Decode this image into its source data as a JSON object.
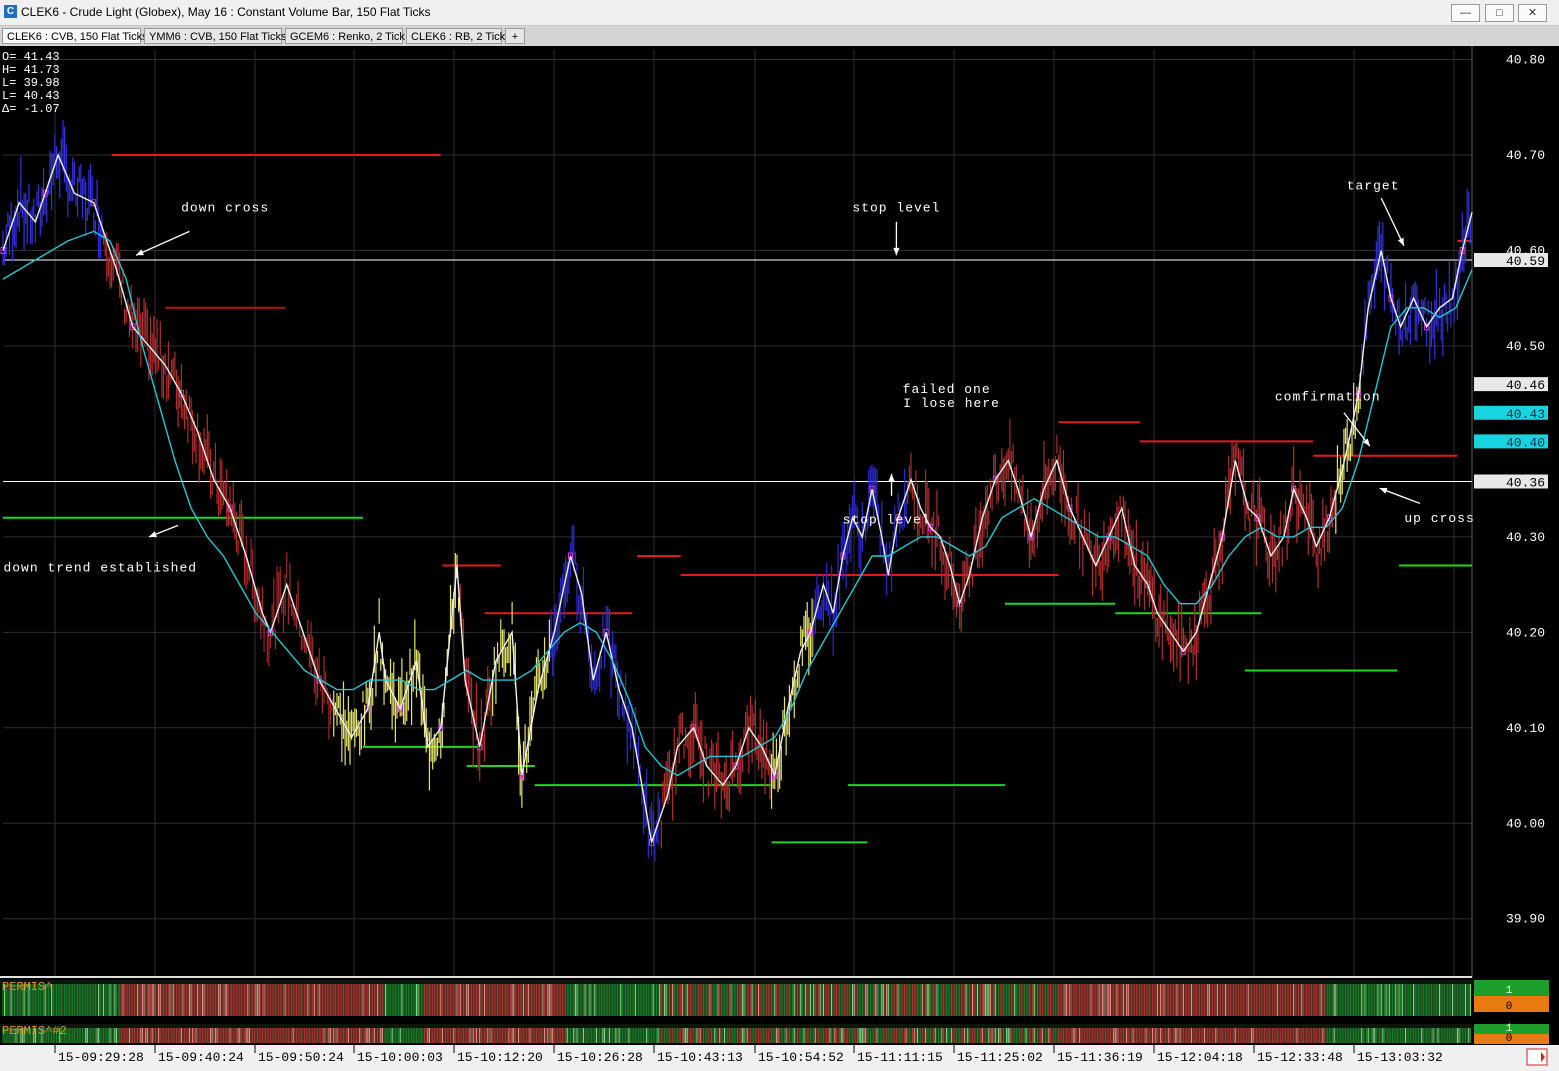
{
  "window": {
    "title": "CLEK6 - Crude Light (Globex), May 16 : Constant Volume Bar, 150 Flat Ticks",
    "minimize_label": "—",
    "maximize_label": "□",
    "close_label": "✕"
  },
  "tabs": [
    {
      "label": "CLEK6 : CVB, 150 Flat Ticks",
      "active": true
    },
    {
      "label": "YMM6 : CVB, 150 Flat Ticks",
      "active": false
    },
    {
      "label": "GCEM6 : Renko, 2 Tick",
      "active": false
    },
    {
      "label": "CLEK6 : RB, 2 Tick",
      "active": false
    }
  ],
  "add_tab_label": "+",
  "ohlc_readout": [
    "O=  41.43",
    "H=  41.73",
    "L=  39.98",
    "L=  40.43",
    "Δ=  -1.07"
  ],
  "chart_data": {
    "type": "line",
    "y_range": [
      39.84,
      40.81
    ],
    "y_ticks": [
      "40.80",
      "40.70",
      "40.60",
      "40.50",
      "40.30",
      "40.20",
      "40.10",
      "40.00",
      "39.90"
    ],
    "x_tick_labels": [
      "15-09:29:28",
      "15-09:40:24",
      "15-09:50:24",
      "15-10:00:03",
      "15-10:12:20",
      "15-10:26:28",
      "15-10:43:13",
      "15-10:54:52",
      "15-11:11:15",
      "15-11:25:02",
      "15-11:36:19",
      "15-12:04:18",
      "15-12:33:48",
      "15-13:03:32"
    ],
    "price_path": [
      [
        0,
        40.6
      ],
      [
        10,
        40.65
      ],
      [
        20,
        40.63
      ],
      [
        26,
        40.66
      ],
      [
        34,
        40.7
      ],
      [
        44,
        40.66
      ],
      [
        56,
        40.65
      ],
      [
        62,
        40.62
      ],
      [
        70,
        40.58
      ],
      [
        80,
        40.52
      ],
      [
        90,
        40.5
      ],
      [
        100,
        40.48
      ],
      [
        110,
        40.45
      ],
      [
        120,
        40.41
      ],
      [
        130,
        40.36
      ],
      [
        140,
        40.33
      ],
      [
        150,
        40.28
      ],
      [
        160,
        40.22
      ],
      [
        165,
        40.2
      ],
      [
        175,
        40.25
      ],
      [
        185,
        40.2
      ],
      [
        195,
        40.15
      ],
      [
        205,
        40.12
      ],
      [
        215,
        40.09
      ],
      [
        225,
        40.12
      ],
      [
        232,
        40.2
      ],
      [
        236,
        40.15
      ],
      [
        245,
        40.12
      ],
      [
        255,
        40.17
      ],
      [
        262,
        40.08
      ],
      [
        270,
        40.1
      ],
      [
        280,
        40.27
      ],
      [
        285,
        40.15
      ],
      [
        294,
        40.08
      ],
      [
        304,
        40.17
      ],
      [
        314,
        40.2
      ],
      [
        320,
        40.05
      ],
      [
        330,
        40.14
      ],
      [
        340,
        40.2
      ],
      [
        350,
        40.28
      ],
      [
        357,
        40.24
      ],
      [
        364,
        40.15
      ],
      [
        372,
        40.2
      ],
      [
        380,
        40.14
      ],
      [
        388,
        40.1
      ],
      [
        400,
        39.98
      ],
      [
        410,
        40.03
      ],
      [
        416,
        40.08
      ],
      [
        426,
        40.1
      ],
      [
        434,
        40.06
      ],
      [
        444,
        40.04
      ],
      [
        452,
        40.06
      ],
      [
        460,
        40.1
      ],
      [
        468,
        40.08
      ],
      [
        476,
        40.05
      ],
      [
        484,
        40.12
      ],
      [
        492,
        40.18
      ],
      [
        498,
        40.2
      ],
      [
        506,
        40.25
      ],
      [
        512,
        40.22
      ],
      [
        518,
        40.28
      ],
      [
        524,
        40.32
      ],
      [
        530,
        40.3
      ],
      [
        536,
        40.35
      ],
      [
        542,
        40.3
      ],
      [
        546,
        40.26
      ],
      [
        552,
        40.32
      ],
      [
        560,
        40.36
      ],
      [
        566,
        40.33
      ],
      [
        572,
        40.31
      ],
      [
        578,
        40.3
      ],
      [
        584,
        40.27
      ],
      [
        590,
        40.23
      ],
      [
        596,
        40.26
      ],
      [
        604,
        40.32
      ],
      [
        612,
        40.36
      ],
      [
        620,
        40.38
      ],
      [
        626,
        40.35
      ],
      [
        634,
        40.3
      ],
      [
        642,
        40.35
      ],
      [
        650,
        40.38
      ],
      [
        658,
        40.33
      ],
      [
        666,
        40.3
      ],
      [
        674,
        40.27
      ],
      [
        682,
        40.3
      ],
      [
        690,
        40.33
      ],
      [
        698,
        40.27
      ],
      [
        706,
        40.25
      ],
      [
        712,
        40.22
      ],
      [
        720,
        40.2
      ],
      [
        728,
        40.18
      ],
      [
        736,
        40.2
      ],
      [
        744,
        40.25
      ],
      [
        752,
        40.3
      ],
      [
        760,
        40.38
      ],
      [
        768,
        40.33
      ],
      [
        774,
        40.32
      ],
      [
        782,
        40.28
      ],
      [
        790,
        40.3
      ],
      [
        796,
        40.35
      ],
      [
        804,
        40.32
      ],
      [
        810,
        40.29
      ],
      [
        818,
        40.32
      ],
      [
        826,
        40.37
      ],
      [
        830,
        40.4
      ],
      [
        836,
        40.45
      ],
      [
        842,
        40.54
      ],
      [
        850,
        40.6
      ],
      [
        856,
        40.55
      ],
      [
        862,
        40.52
      ],
      [
        870,
        40.55
      ],
      [
        878,
        40.52
      ],
      [
        886,
        40.54
      ],
      [
        894,
        40.55
      ],
      [
        900,
        40.6
      ],
      [
        906,
        40.64
      ]
    ],
    "moving_average": [
      [
        0,
        40.57
      ],
      [
        20,
        40.59
      ],
      [
        40,
        40.61
      ],
      [
        56,
        40.62
      ],
      [
        66,
        40.61
      ],
      [
        76,
        40.57
      ],
      [
        86,
        40.5
      ],
      [
        96,
        40.44
      ],
      [
        106,
        40.38
      ],
      [
        116,
        40.33
      ],
      [
        126,
        40.3
      ],
      [
        136,
        40.28
      ],
      [
        146,
        40.25
      ],
      [
        156,
        40.22
      ],
      [
        166,
        40.2
      ],
      [
        176,
        40.18
      ],
      [
        186,
        40.16
      ],
      [
        196,
        40.15
      ],
      [
        206,
        40.14
      ],
      [
        216,
        40.14
      ],
      [
        226,
        40.15
      ],
      [
        236,
        40.15
      ],
      [
        246,
        40.15
      ],
      [
        256,
        40.14
      ],
      [
        266,
        40.14
      ],
      [
        276,
        40.15
      ],
      [
        286,
        40.16
      ],
      [
        296,
        40.15
      ],
      [
        306,
        40.15
      ],
      [
        316,
        40.15
      ],
      [
        326,
        40.16
      ],
      [
        336,
        40.18
      ],
      [
        346,
        40.2
      ],
      [
        356,
        40.21
      ],
      [
        366,
        40.2
      ],
      [
        376,
        40.17
      ],
      [
        386,
        40.13
      ],
      [
        396,
        40.08
      ],
      [
        406,
        40.06
      ],
      [
        416,
        40.05
      ],
      [
        426,
        40.06
      ],
      [
        436,
        40.07
      ],
      [
        446,
        40.07
      ],
      [
        456,
        40.07
      ],
      [
        466,
        40.08
      ],
      [
        476,
        40.09
      ],
      [
        486,
        40.12
      ],
      [
        496,
        40.16
      ],
      [
        506,
        40.19
      ],
      [
        516,
        40.22
      ],
      [
        526,
        40.25
      ],
      [
        536,
        40.28
      ],
      [
        546,
        40.28
      ],
      [
        556,
        40.29
      ],
      [
        566,
        40.3
      ],
      [
        576,
        40.3
      ],
      [
        586,
        40.29
      ],
      [
        596,
        40.28
      ],
      [
        606,
        40.29
      ],
      [
        616,
        40.32
      ],
      [
        626,
        40.33
      ],
      [
        636,
        40.34
      ],
      [
        646,
        40.33
      ],
      [
        656,
        40.32
      ],
      [
        666,
        40.31
      ],
      [
        676,
        40.3
      ],
      [
        686,
        40.3
      ],
      [
        696,
        40.29
      ],
      [
        706,
        40.28
      ],
      [
        716,
        40.25
      ],
      [
        726,
        40.23
      ],
      [
        736,
        40.23
      ],
      [
        746,
        40.25
      ],
      [
        756,
        40.28
      ],
      [
        766,
        40.3
      ],
      [
        776,
        40.31
      ],
      [
        786,
        40.3
      ],
      [
        796,
        40.3
      ],
      [
        806,
        40.31
      ],
      [
        816,
        40.31
      ],
      [
        826,
        40.33
      ],
      [
        836,
        40.38
      ],
      [
        846,
        40.45
      ],
      [
        856,
        40.52
      ],
      [
        866,
        40.54
      ],
      [
        876,
        40.54
      ],
      [
        886,
        40.53
      ],
      [
        896,
        40.54
      ],
      [
        906,
        40.58
      ]
    ],
    "bar_segments": [
      {
        "from": 0,
        "to": 62,
        "color": "#3232e6"
      },
      {
        "from": 62,
        "to": 150,
        "color": "#b32d2d"
      },
      {
        "from": 150,
        "to": 204,
        "color": "#9e2a2a"
      },
      {
        "from": 204,
        "to": 252,
        "color": "#e6e36b"
      },
      {
        "from": 252,
        "to": 282,
        "color": "#e6e36b"
      },
      {
        "from": 282,
        "to": 302,
        "color": "#b32d2d"
      },
      {
        "from": 302,
        "to": 338,
        "color": "#e6e36b"
      },
      {
        "from": 338,
        "to": 406,
        "color": "#2e2ecf"
      },
      {
        "from": 406,
        "to": 474,
        "color": "#b32d2d"
      },
      {
        "from": 474,
        "to": 500,
        "color": "#e6e36b"
      },
      {
        "from": 500,
        "to": 558,
        "color": "#2a2ad8"
      },
      {
        "from": 558,
        "to": 660,
        "color": "#a53030"
      },
      {
        "from": 660,
        "to": 760,
        "color": "#b32d2d"
      },
      {
        "from": 760,
        "to": 822,
        "color": "#b03030"
      },
      {
        "from": 822,
        "to": 838,
        "color": "#e6e36b"
      },
      {
        "from": 838,
        "to": 906,
        "color": "#3232d8"
      }
    ],
    "horizontal_levels": [
      {
        "price": 40.59,
        "from": 0,
        "to": 906,
        "color": "#ffffff",
        "label": "40.59"
      },
      {
        "price": 40.358,
        "from": 0,
        "to": 906,
        "color": "#ffffff",
        "label": "40.36"
      },
      {
        "price": 40.7,
        "from": 67,
        "to": 270,
        "color": "#e31a1a"
      },
      {
        "price": 40.54,
        "from": 100,
        "to": 174,
        "color": "#b41414"
      },
      {
        "price": 40.27,
        "from": 271,
        "to": 307,
        "color": "#e31a1a"
      },
      {
        "price": 40.22,
        "from": 297,
        "to": 388,
        "color": "#e31a1a"
      },
      {
        "price": 40.28,
        "from": 391,
        "to": 418,
        "color": "#e31a1a"
      },
      {
        "price": 40.26,
        "from": 418,
        "to": 651,
        "color": "#e31a1a"
      },
      {
        "price": 40.42,
        "from": 651,
        "to": 701,
        "color": "#e31a1a"
      },
      {
        "price": 40.4,
        "from": 701,
        "to": 808,
        "color": "#e31a1a"
      },
      {
        "price": 40.385,
        "from": 808,
        "to": 897,
        "color": "#e31a1a"
      },
      {
        "price": 40.61,
        "from": 897,
        "to": 906,
        "color": "#e31a1a"
      },
      {
        "price": 40.32,
        "from": 0,
        "to": 222,
        "color": "#1ed81e"
      },
      {
        "price": 40.08,
        "from": 222,
        "to": 293,
        "color": "#1ed81e"
      },
      {
        "price": 40.06,
        "from": 286,
        "to": 328,
        "color": "#1ed81e"
      },
      {
        "price": 40.04,
        "from": 328,
        "to": 474,
        "color": "#1ed81e"
      },
      {
        "price": 39.98,
        "from": 474,
        "to": 533,
        "color": "#1ed81e"
      },
      {
        "price": 40.04,
        "from": 521,
        "to": 618,
        "color": "#1ed81e"
      },
      {
        "price": 40.23,
        "from": 618,
        "to": 686,
        "color": "#1ed81e"
      },
      {
        "price": 40.22,
        "from": 686,
        "to": 776,
        "color": "#1ed81e"
      },
      {
        "price": 40.16,
        "from": 766,
        "to": 860,
        "color": "#1ed81e"
      },
      {
        "price": 40.27,
        "from": 861,
        "to": 906,
        "color": "#1ed81e"
      }
    ],
    "price_labels_right": [
      {
        "price": 40.46,
        "label": "40.46",
        "bg": "#e8e8e8",
        "fg": "#000000"
      },
      {
        "price": 40.43,
        "label": "40.43",
        "bg": "#18d4e0",
        "fg": "#003040"
      },
      {
        "price": 40.4,
        "label": "40.40",
        "bg": "#18d4e0",
        "fg": "#003040"
      }
    ],
    "annotations": [
      {
        "text": "down cross",
        "price": 40.645,
        "x": 137,
        "arrow": [
          [
            82,
            40.595
          ],
          [
            115,
            40.62
          ]
        ]
      },
      {
        "text": "down trend established",
        "price": 40.268,
        "x": 60,
        "arrow": [
          [
            90,
            40.3
          ],
          [
            108,
            40.312
          ]
        ]
      },
      {
        "text": "stop level",
        "price": 40.645,
        "x": 551,
        "arrow": [
          [
            551,
            40.595
          ],
          [
            551,
            40.63
          ]
        ]
      },
      {
        "text": "stop level",
        "price": 40.318,
        "x": 545,
        "arrow": [
          [
            548,
            40.366
          ],
          [
            548,
            40.343
          ]
        ]
      },
      {
        "text": "failed one",
        "price": 40.455,
        "x": 582
      },
      {
        "text": "I lose here",
        "price": 40.44,
        "x": 585
      },
      {
        "text": "comfirmation",
        "price": 40.447,
        "x": 817,
        "arrow": [
          [
            843,
            40.395
          ],
          [
            827,
            40.43
          ]
        ]
      },
      {
        "text": "up cross",
        "price": 40.32,
        "x": 886,
        "arrow": [
          [
            849,
            40.351
          ],
          [
            874,
            40.335
          ]
        ]
      },
      {
        "text": "target",
        "price": 40.668,
        "x": 845,
        "arrow": [
          [
            864,
            40.605
          ],
          [
            850,
            40.655
          ]
        ]
      }
    ],
    "indicators": [
      {
        "name": "PERMIS^",
        "value_top": "1",
        "value_bottom": "0"
      },
      {
        "name": "PERMIS^#2",
        "value_top": "1",
        "value_bottom": "0"
      }
    ],
    "indicator_segments": [
      {
        "from": 0,
        "to": 72,
        "state": "green"
      },
      {
        "from": 72,
        "to": 235,
        "state": "red"
      },
      {
        "from": 235,
        "to": 260,
        "state": "green"
      },
      {
        "from": 260,
        "to": 347,
        "state": "red"
      },
      {
        "from": 347,
        "to": 406,
        "state": "green"
      },
      {
        "from": 406,
        "to": 652,
        "state": "mixed"
      },
      {
        "from": 652,
        "to": 816,
        "state": "red"
      },
      {
        "from": 816,
        "to": 906,
        "state": "green"
      }
    ],
    "colors": {
      "background": "#000000",
      "grid": "#2e2e2e",
      "price_path": "#f0f0f0",
      "moving_average": "#22c7d2",
      "bull": "#2e2ecf",
      "bear": "#b32d2d",
      "neutral": "#e6e36b",
      "indicator_green": "#1d7a2a",
      "indicator_red": "#a23a32"
    }
  }
}
